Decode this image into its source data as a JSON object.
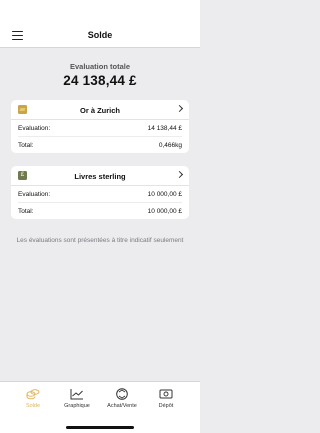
{
  "header": {
    "title": "Solde"
  },
  "summary": {
    "label": "Evaluation totale",
    "value": "24 138,44 £"
  },
  "cards": [
    {
      "title": "Or à Zurich",
      "icon": "gold-bar-icon",
      "rows": [
        {
          "label": "Evaluation:",
          "value": "14 138,44 £"
        },
        {
          "label": "Total:",
          "value": "0,466kg"
        }
      ]
    },
    {
      "title": "Livres sterling",
      "icon": "pound-icon",
      "rows": [
        {
          "label": "Evaluation:",
          "value": "10 000,00 £"
        },
        {
          "label": "Total:",
          "value": "10 000,00 £"
        }
      ]
    }
  ],
  "disclaimer": "Les évaluations sont présentées à titre indicatif seulement",
  "tabs": [
    {
      "label": "Solde",
      "icon": "coins-icon",
      "active": true
    },
    {
      "label": "Graphique",
      "icon": "chart-icon",
      "active": false
    },
    {
      "label": "Achat/Vente",
      "icon": "globe-exchange-icon",
      "active": false
    },
    {
      "label": "Dépôt",
      "icon": "banknote-icon",
      "active": false
    }
  ],
  "colors": {
    "accent": "#e0b45a",
    "background": "#ececef"
  }
}
